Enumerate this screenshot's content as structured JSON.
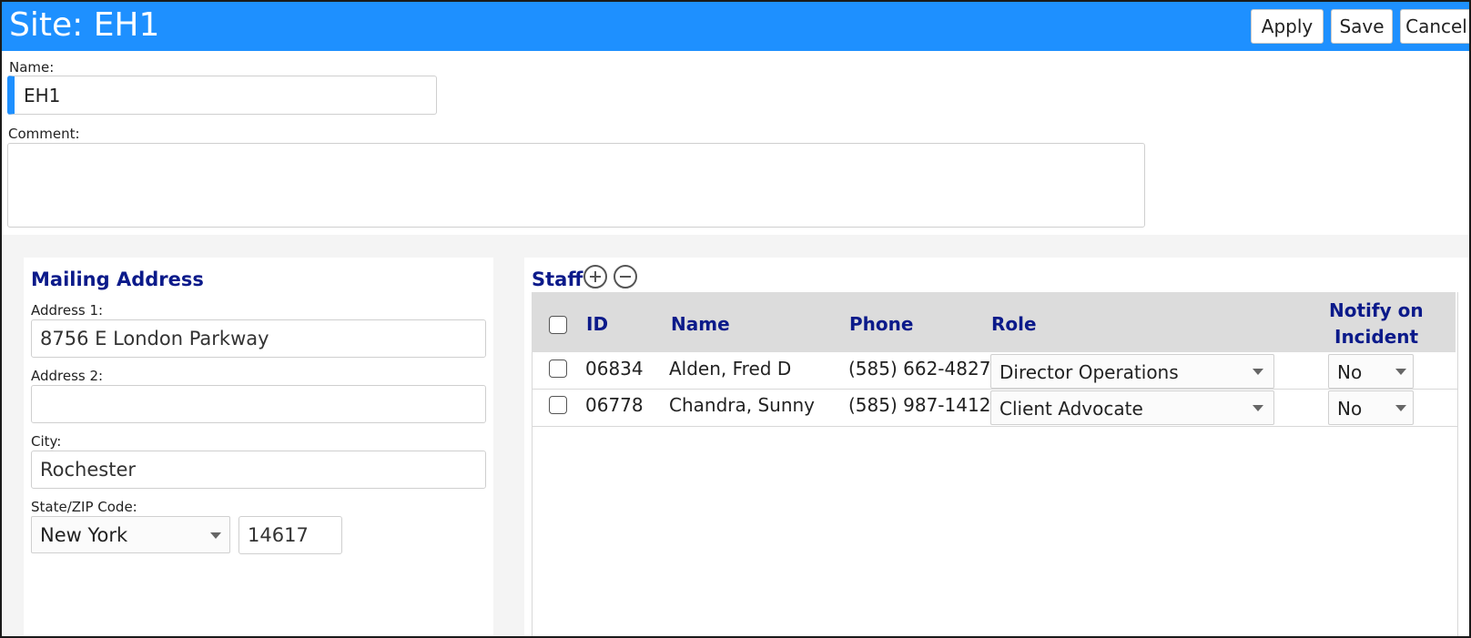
{
  "header": {
    "title": "Site: EH1",
    "apply_label": "Apply",
    "save_label": "Save",
    "cancel_label": "Cancel",
    "bar_color": "#1e90ff"
  },
  "form": {
    "name_label": "Name:",
    "name_value": "EH1",
    "comment_label": "Comment:",
    "comment_value": ""
  },
  "mailing": {
    "title": "Mailing Address",
    "address1_label": "Address 1:",
    "address1_value": "8756 E London Parkway",
    "address2_label": "Address 2:",
    "address2_value": "",
    "city_label": "City:",
    "city_value": "Rochester",
    "state_zip_label": "State/ZIP Code:",
    "state_value": "New York",
    "zip_value": "14617"
  },
  "staff": {
    "title": "Staff",
    "add_icon": "plus-circle-icon",
    "remove_icon": "minus-circle-icon",
    "columns": {
      "id": "ID",
      "name": "Name",
      "phone": "Phone",
      "role": "Role",
      "notify_line1": "Notify on",
      "notify_line2": "Incident"
    },
    "rows": [
      {
        "id": "06834",
        "name": "Alden, Fred D",
        "phone": "(585) 662-4827",
        "role": "Director Operations",
        "notify": "No"
      },
      {
        "id": "06778",
        "name": "Chandra, Sunny",
        "phone": "(585) 987-1412",
        "role": "Client Advocate",
        "notify": "No"
      }
    ]
  }
}
